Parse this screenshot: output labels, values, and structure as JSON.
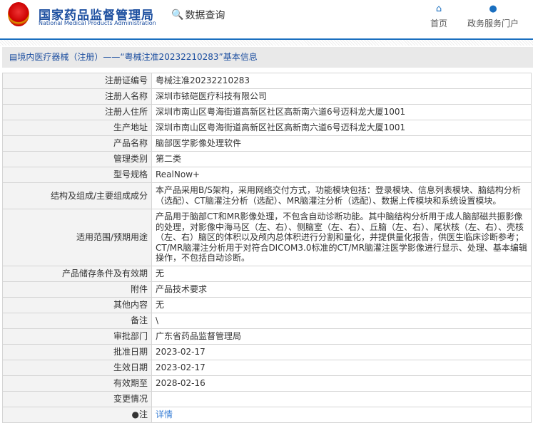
{
  "header": {
    "org_cn": "国家药品监督管理局",
    "org_en": "National Medical Products Administration",
    "query": "数据查询",
    "nav": [
      {
        "icon": "home-icon",
        "label": "首页"
      },
      {
        "icon": "user-icon",
        "label": "政务服务门户"
      }
    ]
  },
  "breadcrumb": "境内医疗器械（注册）——“粤械注准20232210283”基本信息",
  "rows": [
    {
      "label": "注册证编号",
      "value": "粤械注准20232210283"
    },
    {
      "label": "注册人名称",
      "value": "深圳市铱硙医疗科技有限公司"
    },
    {
      "label": "注册人住所",
      "value": "深圳市南山区粤海街道高新区社区高新南六道6号迈科龙大厦1001"
    },
    {
      "label": "生产地址",
      "value": "深圳市南山区粤海街道高新区社区高新南六道6号迈科龙大厦1001"
    },
    {
      "label": "产品名称",
      "value": "脑部医学影像处理软件"
    },
    {
      "label": "管理类别",
      "value": "第二类"
    },
    {
      "label": "型号规格",
      "value": "RealNow+"
    },
    {
      "label": "结构及组成/主要组成成分",
      "value": "本产品采用B/S架构，采用网络交付方式，功能模块包括：登录模块、信息列表模块、脑结构分析（选配）、CT脑灌注分析（选配）、MR脑灌注分析（选配）、数据上传模块和系统设置模块。"
    },
    {
      "label": "适用范围/预期用途",
      "value": "产品用于脑部CT和MR影像处理，不包含自动诊断功能。其中脑结构分析用于成人脑部磁共振影像的处理，对影像中海马区（左、右）、侧脑室（左、右）、丘脑（左、右）、尾状核（左、右）、壳核（左、右）脑区的体积以及颅内总体积进行分割和量化，并提供量化报告，供医生临床诊断参考；CT/MR脑灌注分析用于对符合DICOM3.0标准的CT/MR脑灌注医学影像进行显示、处理、基本编辑操作，不包括自动诊断。"
    },
    {
      "label": "产品储存条件及有效期",
      "value": "无"
    },
    {
      "label": "附件",
      "value": "产品技术要求"
    },
    {
      "label": "其他内容",
      "value": "无"
    },
    {
      "label": "备注",
      "value": "\\"
    },
    {
      "label": "审批部门",
      "value": "广东省药品监督管理局"
    },
    {
      "label": "批准日期",
      "value": "2023-02-17"
    },
    {
      "label": "生效日期",
      "value": "2023-02-17"
    },
    {
      "label": "有效期至",
      "value": "2028-02-16"
    },
    {
      "label": "变更情况",
      "value": ""
    }
  ],
  "note": {
    "label": "注",
    "link": "详情"
  }
}
